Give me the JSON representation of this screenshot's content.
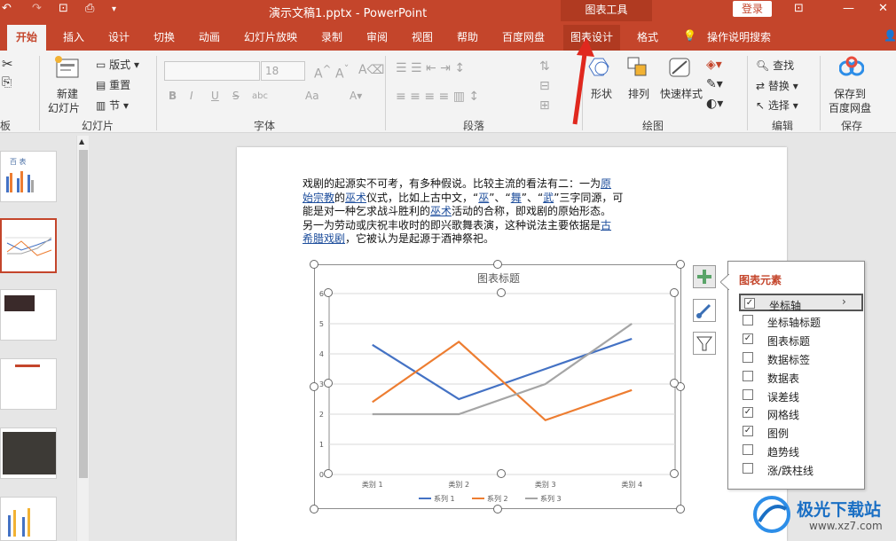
{
  "titlebar": {
    "doc_title": "演示文稿1.pptx - PowerPoint",
    "context_tool": "图表工具",
    "login": "登录"
  },
  "tabs": [
    {
      "label": "开始"
    },
    {
      "label": "插入"
    },
    {
      "label": "设计"
    },
    {
      "label": "切换"
    },
    {
      "label": "动画"
    },
    {
      "label": "幻灯片放映"
    },
    {
      "label": "录制"
    },
    {
      "label": "审阅"
    },
    {
      "label": "视图"
    },
    {
      "label": "帮助"
    },
    {
      "label": "百度网盘"
    },
    {
      "label": "图表设计"
    },
    {
      "label": "格式"
    }
  ],
  "tell_me": "操作说明搜索",
  "ribbon": {
    "layout": "版式",
    "reset": "重置",
    "section": "节",
    "new_slide_1": "新建",
    "new_slide_2": "幻灯片",
    "slides_group": "幻灯片",
    "font_group": "字体",
    "paragraph_group": "段落",
    "drawing_group": "绘图",
    "editing_group": "编辑",
    "save_group": "保存",
    "font_size": "18",
    "shape": "形状",
    "arrange": "排列",
    "quick_styles": "快速样式",
    "find": "查找",
    "replace": "替换",
    "select": "选择",
    "save_to_1": "保存到",
    "save_to_2": "百度网盘",
    "bold": "B",
    "italic": "I",
    "underline": "U",
    "strike": "S",
    "spacing": "abc",
    "aa_case": "Aa"
  },
  "slide_text": {
    "l1a": "戏剧的起源实不可考，有多种假说。比较主流的看法有二：一为",
    "l1b": "原",
    "l2a": "始宗教",
    "l2b": "的",
    "l2c": "巫术",
    "l2d": "仪式，比如上古中文，“",
    "l2e": "巫",
    "l2f": "”、“",
    "l2g": "舞",
    "l2h": "”、“",
    "l2i": "武",
    "l2j": "”三字同源，可",
    "l3a": "能是对一种乞求战斗胜利的",
    "l3b": "巫术",
    "l3c": "活动的合称，即戏剧的原始形态。",
    "l4a": "另一为劳动或庆祝丰收时的即兴歌舞表演，这种说法主要依据是",
    "l4b": "古",
    "l5a": "希腊戏剧",
    "l5b": "，它被认为是起源于酒神祭祀。"
  },
  "chart_data": {
    "type": "line",
    "title": "图表标题",
    "categories": [
      "类别 1",
      "类别 2",
      "类别 3",
      "类别 4"
    ],
    "series": [
      {
        "name": "系列 1",
        "values": [
          4.3,
          2.5,
          3.5,
          4.5
        ],
        "color": "#4472c4"
      },
      {
        "name": "系列 2",
        "values": [
          2.4,
          4.4,
          1.8,
          2.8
        ],
        "color": "#ed7d31"
      },
      {
        "name": "系列 3",
        "values": [
          2,
          2,
          3,
          5
        ],
        "color": "#a5a5a5"
      }
    ],
    "ylim": [
      0,
      6
    ],
    "yticks": [
      "0",
      "1",
      "2",
      "3",
      "4",
      "5",
      "6"
    ],
    "grid": true,
    "legend": "bottom"
  },
  "chart_elements": {
    "title": "图表元素",
    "options": [
      {
        "label": "坐标轴",
        "checked": true
      },
      {
        "label": "坐标轴标题",
        "checked": false
      },
      {
        "label": "图表标题",
        "checked": true
      },
      {
        "label": "数据标签",
        "checked": false
      },
      {
        "label": "数据表",
        "checked": false
      },
      {
        "label": "误差线",
        "checked": false
      },
      {
        "label": "网格线",
        "checked": true
      },
      {
        "label": "图例",
        "checked": true
      },
      {
        "label": "趋势线",
        "checked": false
      },
      {
        "label": "涨/跌柱线",
        "checked": false
      }
    ]
  },
  "watermark": {
    "brand": "极光下载站",
    "url": "www.xz7.com"
  },
  "thumbs": {
    "t1": "百  表"
  },
  "colors": {
    "accent": "#c4452b",
    "arrow": "#e0281e"
  }
}
